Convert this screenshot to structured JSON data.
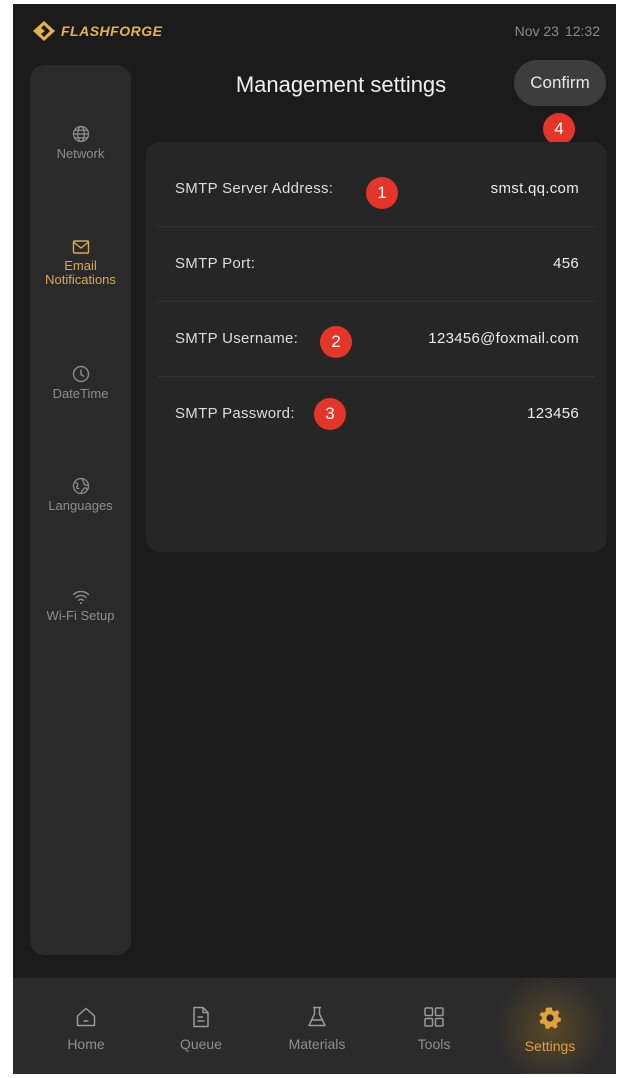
{
  "status_bar": {
    "brand": "FLASHFORGE",
    "date": "Nov 23",
    "time": "12:32"
  },
  "sidebar": {
    "items": [
      {
        "label": "Network",
        "icon": "globe-icon",
        "active": false
      },
      {
        "label": "Email Notifications",
        "icon": "mail-icon",
        "active": true
      },
      {
        "label": "DateTime",
        "icon": "clock-icon",
        "active": false
      },
      {
        "label": "Languages",
        "icon": "languages-icon",
        "active": false
      },
      {
        "label": "Wi-Fi Setup",
        "icon": "wifi-icon",
        "active": false
      }
    ]
  },
  "header": {
    "title": "Management settings",
    "confirm_label": "Confirm"
  },
  "settings": {
    "rows": [
      {
        "label": "SMTP Server Address:",
        "value": "smst.qq.com"
      },
      {
        "label": "SMTP Port:",
        "value": "456"
      },
      {
        "label": "SMTP Username:",
        "value": "123456@foxmail.com"
      },
      {
        "label": "SMTP Password:",
        "value": "123456"
      }
    ]
  },
  "annotations": [
    "1",
    "2",
    "3",
    "4"
  ],
  "bottom_nav": {
    "tabs": [
      {
        "label": "Home",
        "icon": "home-icon",
        "active": false
      },
      {
        "label": "Queue",
        "icon": "document-icon",
        "active": false
      },
      {
        "label": "Materials",
        "icon": "flask-icon",
        "active": false
      },
      {
        "label": "Tools",
        "icon": "grid-icon",
        "active": false
      },
      {
        "label": "Settings",
        "icon": "gear-icon",
        "active": true
      }
    ]
  },
  "colors": {
    "accent": "#e0a23a",
    "background": "#1b1b1b",
    "badge": "#e53529"
  }
}
